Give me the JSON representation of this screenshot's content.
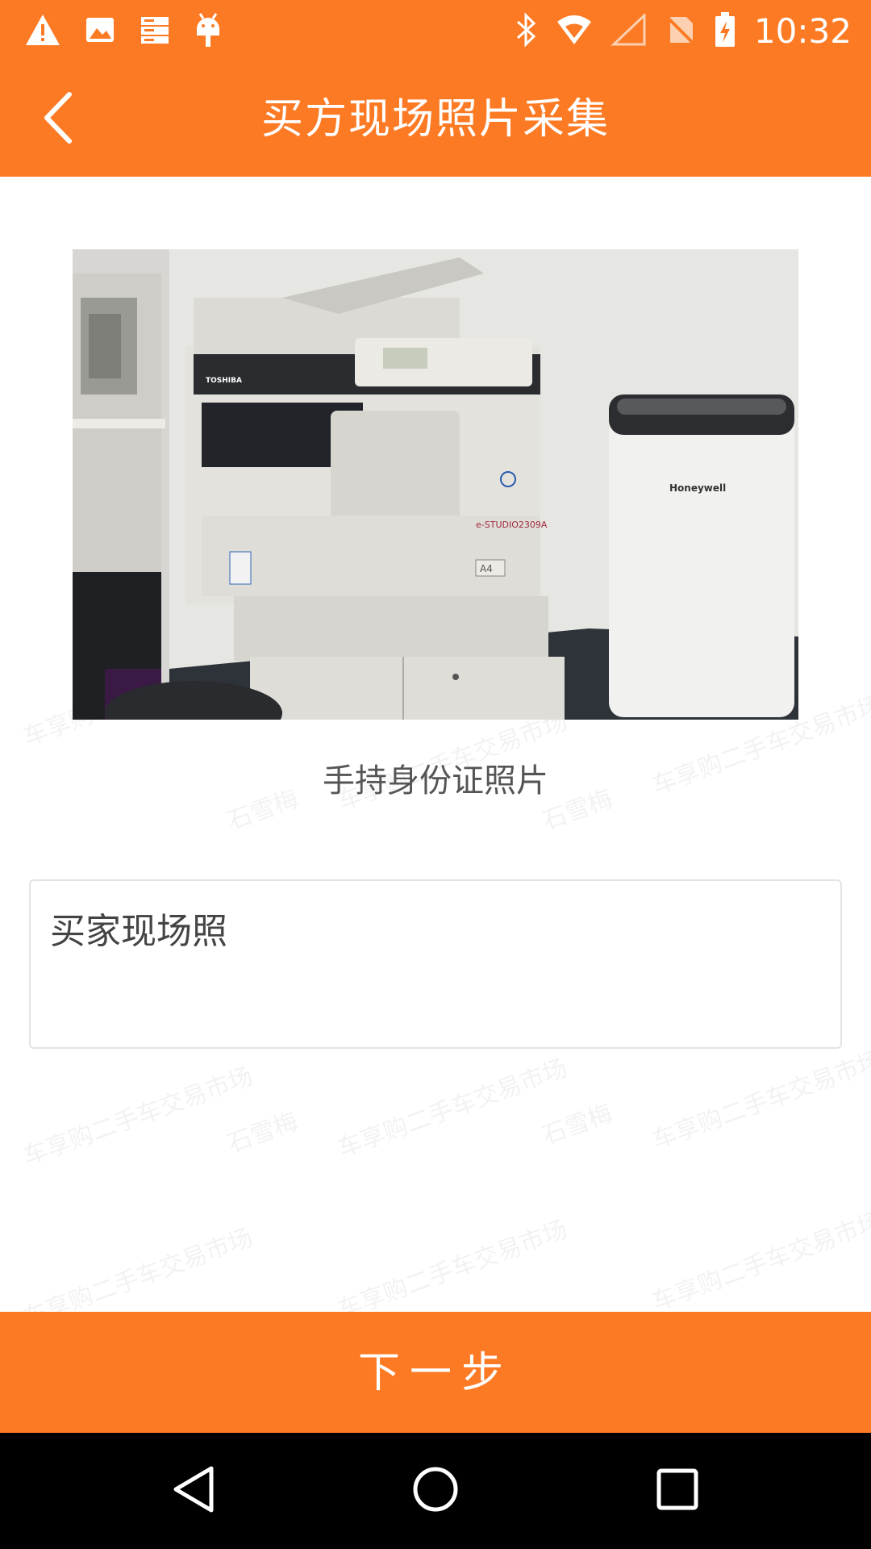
{
  "status_bar": {
    "time": "10:32",
    "left_icons": [
      "warning-icon",
      "image-icon",
      "storage-icon",
      "android-icon"
    ],
    "right_icons": [
      "bluetooth-icon",
      "wifi-icon",
      "signal-icon",
      "no-sim-icon",
      "battery-charging-icon"
    ]
  },
  "app_bar": {
    "title": "买方现场照片采集",
    "back_icon": "chevron-left-icon"
  },
  "photo": {
    "caption": "手持身份证照片",
    "printer_brand": "TOSHIBA",
    "printer_model": "e-STUDIO2309A",
    "paper_label": "A4",
    "purifier_brand": "Honeywell"
  },
  "note": {
    "value": "买家现场照"
  },
  "next_button": {
    "label": "下一步"
  },
  "watermark": {
    "line1": "车享购二手车交易市场",
    "line2": "石雪梅"
  },
  "colors": {
    "accent": "#fd7a24",
    "nav_bar": "#000000"
  }
}
